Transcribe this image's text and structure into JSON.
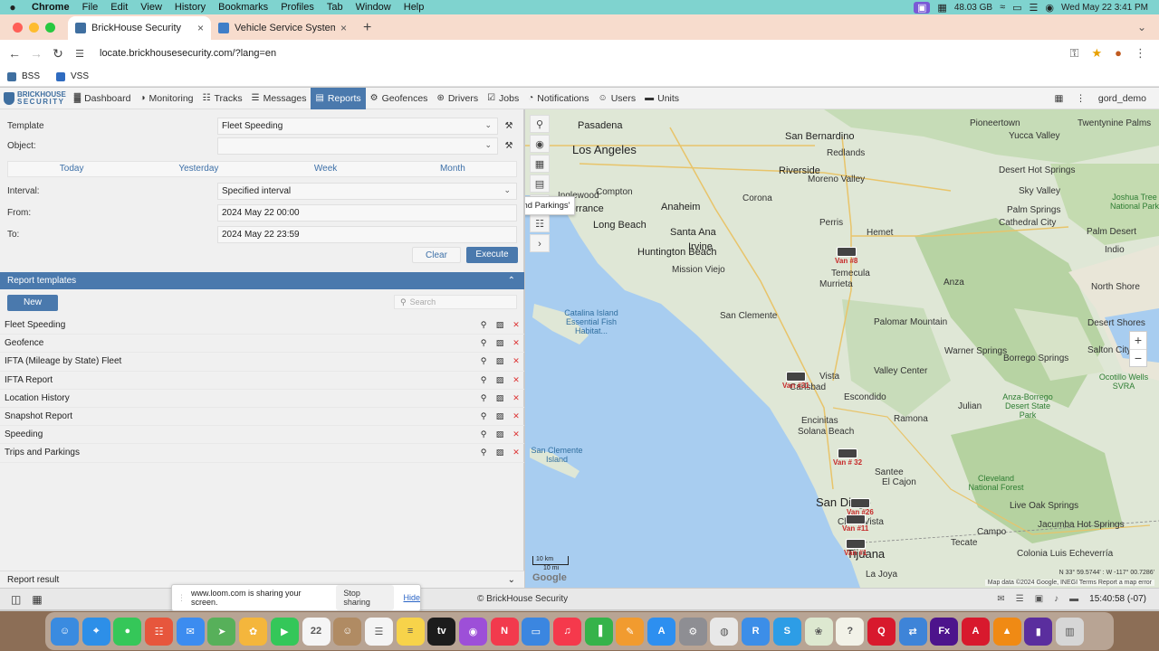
{
  "menubar": {
    "app": "Chrome",
    "items": [
      "File",
      "Edit",
      "View",
      "History",
      "Bookmarks",
      "Profiles",
      "Tab",
      "Window",
      "Help"
    ],
    "memory": "48.03 GB",
    "clock": "Wed May 22  3:41 PM"
  },
  "tabs": [
    {
      "title": "BrickHouse Security",
      "active": true,
      "color": "#3f6fa0"
    },
    {
      "title": "Vehicle Service System",
      "active": false,
      "color": "#3f7ec8"
    }
  ],
  "address": {
    "url": "locate.brickhousesecurity.com/?lang=en"
  },
  "bookmarks": [
    {
      "label": "BSS",
      "color": "#3f6fa0"
    },
    {
      "label": "VSS",
      "color": "#2f6bc0"
    }
  ],
  "appnav": {
    "logo_line1": "BRICKHOUSE",
    "logo_line2": "SECURITY",
    "items": [
      {
        "label": "Dashboard",
        "icon": "dashboard-icon",
        "glyph": "▓",
        "active": false
      },
      {
        "label": "Monitoring",
        "icon": "monitoring-icon",
        "glyph": "◑",
        "active": false
      },
      {
        "label": "Tracks",
        "icon": "tracks-icon",
        "glyph": "☷",
        "active": false
      },
      {
        "label": "Messages",
        "icon": "messages-icon",
        "glyph": "☰",
        "active": false
      },
      {
        "label": "Reports",
        "icon": "reports-icon",
        "glyph": "▤",
        "active": true
      },
      {
        "label": "Geofences",
        "icon": "geofences-icon",
        "glyph": "⚙",
        "active": false
      },
      {
        "label": "Drivers",
        "icon": "drivers-icon",
        "glyph": "⊛",
        "active": false
      },
      {
        "label": "Jobs",
        "icon": "jobs-icon",
        "glyph": "☑",
        "active": false
      },
      {
        "label": "Notifications",
        "icon": "notifications-icon",
        "glyph": "◔",
        "active": false
      },
      {
        "label": "Users",
        "icon": "users-icon",
        "glyph": "☺",
        "active": false
      },
      {
        "label": "Units",
        "icon": "units-icon",
        "glyph": "▬",
        "active": false
      }
    ],
    "user": "gord_demo"
  },
  "form": {
    "template_label": "Template",
    "template_value": "Fleet Speeding",
    "object_label": "Object:",
    "object_value": "",
    "periods": [
      "Today",
      "Yesterday",
      "Week",
      "Month"
    ],
    "interval_label": "Interval:",
    "interval_value": "Specified interval",
    "from_label": "From:",
    "from_value": "2024 May 22 00:00",
    "to_label": "To:",
    "to_value": "2024 May 22 23:59",
    "clear_label": "Clear",
    "execute_label": "Execute"
  },
  "templates": {
    "header": "Report templates",
    "new_label": "New",
    "search_placeholder": "Search",
    "items": [
      "Fleet Speeding",
      "Geofence",
      "IFTA (Mileage by State) Fleet",
      "IFTA Report",
      "Location History",
      "Snapshot Report",
      "Speeding",
      "Trips and Parkings"
    ]
  },
  "report_result": "Report result",
  "map": {
    "tooltip": "Execute 'Trips and Parkings'",
    "labels": [
      {
        "text": "Pasadena",
        "size": "mid"
      },
      {
        "text": "Los Angeles",
        "size": "big"
      },
      {
        "text": "San Bernardino",
        "size": "mid"
      },
      {
        "text": "Pioneertown",
        "size": "normal"
      },
      {
        "text": "Twentynine Palms",
        "size": "normal"
      },
      {
        "text": "Yucca Valley",
        "size": "normal"
      },
      {
        "text": "Redlands",
        "size": "normal"
      },
      {
        "text": "Riverside",
        "size": "mid"
      },
      {
        "text": "Moreno Valley",
        "size": "normal"
      },
      {
        "text": "Desert Hot Springs",
        "size": "normal"
      },
      {
        "text": "Sky Valley",
        "size": "normal"
      },
      {
        "text": "Joshua Tree National Park",
        "size": "green"
      },
      {
        "text": "Compton",
        "size": "normal"
      },
      {
        "text": "Inglewood",
        "size": "normal"
      },
      {
        "text": "Torrance",
        "size": "mid"
      },
      {
        "text": "Long Beach",
        "size": "mid"
      },
      {
        "text": "Anaheim",
        "size": "mid"
      },
      {
        "text": "Corona",
        "size": "normal"
      },
      {
        "text": "Palm Springs",
        "size": "normal"
      },
      {
        "text": "Cathedral City",
        "size": "normal"
      },
      {
        "text": "Santa Ana",
        "size": "mid"
      },
      {
        "text": "Irvine",
        "size": "mid"
      },
      {
        "text": "Huntington Beach",
        "size": "mid"
      },
      {
        "text": "Mission Viejo",
        "size": "normal"
      },
      {
        "text": "Perris",
        "size": "normal"
      },
      {
        "text": "Hemet",
        "size": "normal"
      },
      {
        "text": "Palm Desert",
        "size": "normal"
      },
      {
        "text": "Indio",
        "size": "normal"
      },
      {
        "text": "Murrieta",
        "size": "normal"
      },
      {
        "text": "Temecula",
        "size": "normal"
      },
      {
        "text": "Anza",
        "size": "normal"
      },
      {
        "text": "North Shore",
        "size": "normal"
      },
      {
        "text": "San Clemente",
        "size": "normal"
      },
      {
        "text": "Catalina Island Essential Fish Habitat...",
        "size": "water"
      },
      {
        "text": "Palomar Mountain",
        "size": "normal"
      },
      {
        "text": "Desert Shores",
        "size": "normal"
      },
      {
        "text": "Salton City",
        "size": "normal"
      },
      {
        "text": "Warner Springs",
        "size": "normal"
      },
      {
        "text": "Borrego Springs",
        "size": "normal"
      },
      {
        "text": "Vista",
        "size": "normal"
      },
      {
        "text": "Valley Center",
        "size": "normal"
      },
      {
        "text": "Carlsbad",
        "size": "normal"
      },
      {
        "text": "Escondido",
        "size": "normal"
      },
      {
        "text": "Ocotillo Wells SVRA",
        "size": "green"
      },
      {
        "text": "Julian",
        "size": "normal"
      },
      {
        "text": "Encinitas",
        "size": "normal"
      },
      {
        "text": "Ramona",
        "size": "normal"
      },
      {
        "text": "Anza-Borrego Desert State Park",
        "size": "green"
      },
      {
        "text": "Solana Beach",
        "size": "normal"
      },
      {
        "text": "San Clemente Island",
        "size": "water"
      },
      {
        "text": "Santee",
        "size": "normal"
      },
      {
        "text": "El Cajon",
        "size": "normal"
      },
      {
        "text": "Cleveland National Forest",
        "size": "green"
      },
      {
        "text": "San Diego",
        "size": "big"
      },
      {
        "text": "Chula Vista",
        "size": "normal"
      },
      {
        "text": "Live Oak Springs",
        "size": "normal"
      },
      {
        "text": "Campo",
        "size": "normal"
      },
      {
        "text": "Jacumba Hot Springs",
        "size": "normal"
      },
      {
        "text": "Tijuana",
        "size": "big"
      },
      {
        "text": "La Joya",
        "size": "normal"
      },
      {
        "text": "Tecate",
        "size": "normal"
      },
      {
        "text": "Colonia Luis Echeverría",
        "size": "normal"
      }
    ],
    "vans": [
      "Van #8",
      "Van #31",
      "Van # 32",
      "Van #26",
      "Van #11",
      "Van #1"
    ],
    "scale_km": "10 km",
    "scale_mi": "10 mi",
    "google": "Google",
    "coords": "N 33° 59.5744' : W -117° 00.7286'",
    "attribution": "Map data ©2024 Google, INEGI   Terms   Report a map error"
  },
  "statusbar": {
    "copyright": "© BrickHouse Security",
    "time": "15:40:58 (-07)"
  },
  "share": {
    "text": "www.loom.com is sharing your screen.",
    "stop": "Stop sharing",
    "hide": "Hide"
  },
  "dock": {
    "calendar_day": "22",
    "apps": [
      {
        "name": "finder-icon",
        "color": "#3a8be0",
        "glyph": "☺"
      },
      {
        "name": "safari-icon",
        "color": "#2d8fe8",
        "glyph": "⌖"
      },
      {
        "name": "messages-app-icon",
        "color": "#35c759",
        "glyph": "●"
      },
      {
        "name": "launchpad-icon",
        "color": "#e7563c",
        "glyph": "☷"
      },
      {
        "name": "mail-icon",
        "color": "#3c8cf0",
        "glyph": "✉"
      },
      {
        "name": "maps-icon",
        "color": "#57b05a",
        "glyph": "➤"
      },
      {
        "name": "photos-icon",
        "color": "#f4b63c",
        "glyph": "✿"
      },
      {
        "name": "facetime-icon",
        "color": "#34c759",
        "glyph": "▶"
      },
      {
        "name": "calendar-icon",
        "color": "#f5f5f5",
        "glyph": "22"
      },
      {
        "name": "contacts-icon",
        "color": "#b08b63",
        "glyph": "☺"
      },
      {
        "name": "reminders-icon",
        "color": "#f4f4f4",
        "glyph": "☰"
      },
      {
        "name": "notes-icon",
        "color": "#f7d34a",
        "glyph": "≡"
      },
      {
        "name": "tv-icon",
        "color": "#1c1c1c",
        "glyph": "tv"
      },
      {
        "name": "podcasts-icon",
        "color": "#9d4fd8",
        "glyph": "◉"
      },
      {
        "name": "news-icon",
        "color": "#f23a4d",
        "glyph": "N"
      },
      {
        "name": "keynote-icon",
        "color": "#3b86e0",
        "glyph": "▭"
      },
      {
        "name": "music-icon",
        "color": "#f5394c",
        "glyph": "♫"
      },
      {
        "name": "numbers-icon",
        "color": "#35b34a",
        "glyph": "▐"
      },
      {
        "name": "pages-icon",
        "color": "#f19b2f",
        "glyph": "✎"
      },
      {
        "name": "appstore-icon",
        "color": "#2d8ff0",
        "glyph": "A"
      },
      {
        "name": "settings-icon",
        "color": "#8e8e93",
        "glyph": "⚙"
      },
      {
        "name": "chrome-icon",
        "color": "#e8e8e8",
        "glyph": "◍"
      },
      {
        "name": "r-app-icon",
        "color": "#3c8ee8",
        "glyph": "R"
      },
      {
        "name": "s-app-icon",
        "color": "#2d9de6",
        "glyph": "S"
      },
      {
        "name": "silverlight-icon",
        "color": "#dde8d0",
        "glyph": "❀"
      },
      {
        "name": "help-icon",
        "color": "#f2f2e8",
        "glyph": "?"
      },
      {
        "name": "q-app-icon",
        "color": "#d8192d",
        "glyph": "Q"
      },
      {
        "name": "migration-icon",
        "color": "#3e84d8",
        "glyph": "⇄"
      },
      {
        "name": "fedex-icon",
        "color": "#4d148c",
        "glyph": "Fx"
      },
      {
        "name": "acrobat-icon",
        "color": "#d8192d",
        "glyph": "A"
      },
      {
        "name": "vlc-icon",
        "color": "#f08a14",
        "glyph": "▲"
      },
      {
        "name": "folder-icon",
        "color": "#5a2e9e",
        "glyph": "▮"
      },
      {
        "name": "trash-icon",
        "color": "#d6d6d6",
        "glyph": "▥"
      }
    ]
  }
}
